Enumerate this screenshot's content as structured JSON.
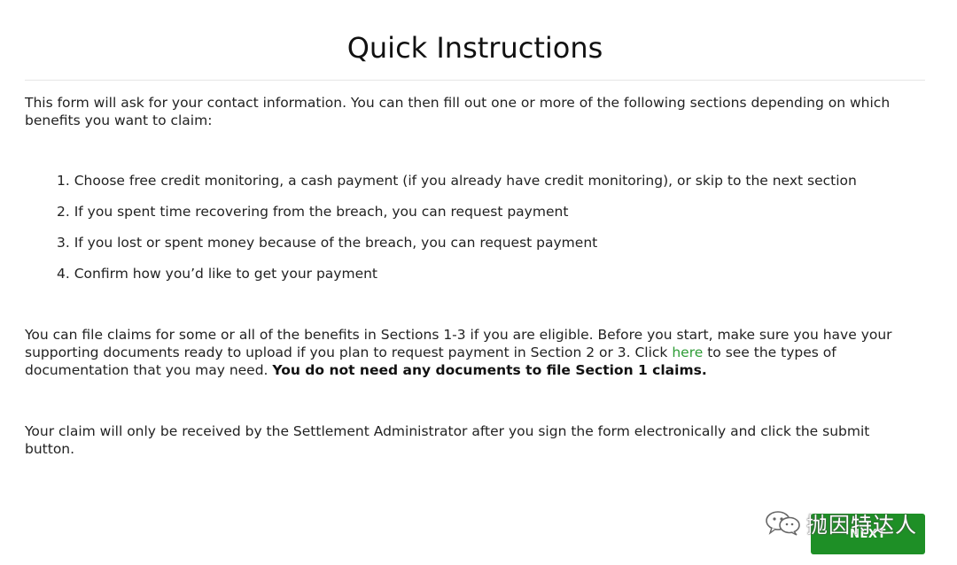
{
  "page": {
    "title": "Quick Instructions",
    "intro": "This form will ask for your contact information. You can then fill out one or more of the following sections depending on which benefits you want to claim:",
    "steps": [
      "1. Choose free credit monitoring, a cash payment (if you already have credit monitoring), or skip to the next section",
      "2. If you spent time recovering from the breach, you can request payment",
      "3. If you lost or spent money because of the breach, you can request payment",
      "4. Confirm how you’d like to get your payment"
    ],
    "files_note": {
      "before_link": "You can file claims for some or all of the benefits in Sections 1-3 if you are eligible. Before you start, make sure you have your supporting documents ready to upload if you plan to request payment in Section 2 or 3. Click ",
      "link_text": "here",
      "after_link": " to see the types of documentation that you may need. ",
      "bold_text": "You do not need any documents to file Section 1 claims."
    },
    "submit_note": "Your claim will only be received by the Settlement Administrator after you sign the form electronically and click the submit button."
  },
  "footer": {
    "next_label": "NEXT"
  },
  "watermark": {
    "icon": "wechat-icon",
    "text": "抛因特达人"
  },
  "colors": {
    "link": "#2e9c36",
    "button": "#1e8f26",
    "text": "#222222"
  }
}
